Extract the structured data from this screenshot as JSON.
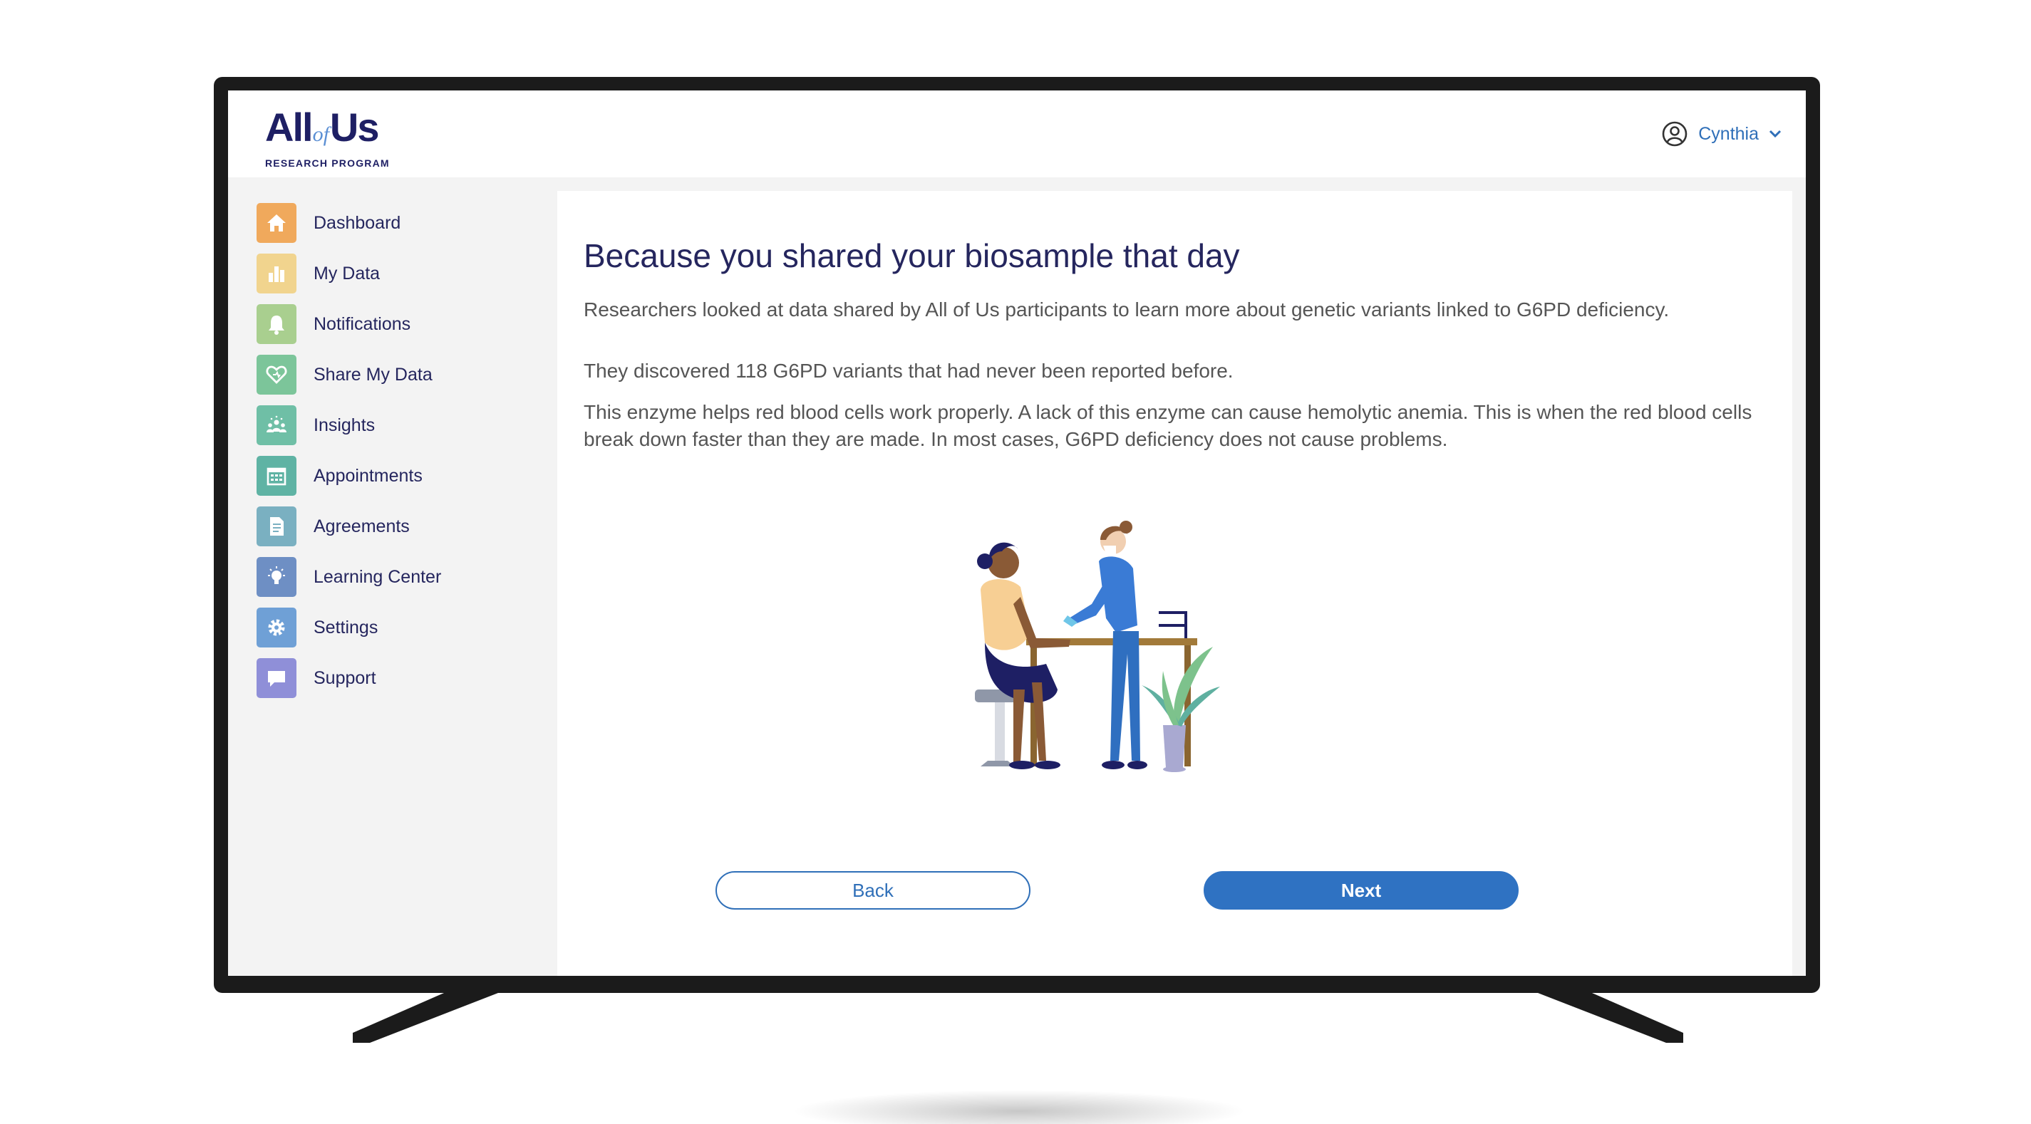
{
  "header": {
    "logo": {
      "main_left": "All",
      "main_of": "of",
      "main_right": "Us",
      "subtitle": "RESEARCH PROGRAM"
    },
    "user": {
      "name": "Cynthia",
      "icon": "user-circle-icon",
      "dropdown_icon": "chevron-down-icon"
    }
  },
  "sidebar": {
    "items": [
      {
        "label": "Dashboard",
        "icon": "home-icon",
        "color": "#f0a95c"
      },
      {
        "label": "My Data",
        "icon": "bar-chart-icon",
        "color": "#f1d48e"
      },
      {
        "label": "Notifications",
        "icon": "bell-icon",
        "color": "#a9cf8f"
      },
      {
        "label": "Share My Data",
        "icon": "heart-share-icon",
        "color": "#7cc59a"
      },
      {
        "label": "Insights",
        "icon": "community-icon",
        "color": "#6fbfa6"
      },
      {
        "label": "Appointments",
        "icon": "calendar-icon",
        "color": "#5fb3a4"
      },
      {
        "label": "Agreements",
        "icon": "document-icon",
        "color": "#7ab0c1"
      },
      {
        "label": "Learning Center",
        "icon": "lightbulb-icon",
        "color": "#6e8fc4"
      },
      {
        "label": "Settings",
        "icon": "gear-icon",
        "color": "#6fa0d6"
      },
      {
        "label": "Support",
        "icon": "chat-icon",
        "color": "#8f8fd8"
      }
    ]
  },
  "content": {
    "title": "Because you shared your biosample that day",
    "paragraphs": [
      "Researchers looked at data shared by All of Us participants to learn more about genetic variants linked to G6PD deficiency.",
      "They discovered 118 G6PD variants that had never been reported before.",
      "This enzyme helps red blood cells work properly. A lack of this enzyme can cause hemolytic anemia. This is when the red blood cells break down faster than they are made. In most cases, G6PD deficiency does not cause problems."
    ],
    "illustration": "blood-draw-illustration",
    "back_label": "Back",
    "next_label": "Next"
  },
  "colors": {
    "navy": "#25265e",
    "accent_blue": "#2f72c2",
    "sidebar_bg": "#f3f3f3",
    "tv_frame": "#1b1b1b"
  }
}
